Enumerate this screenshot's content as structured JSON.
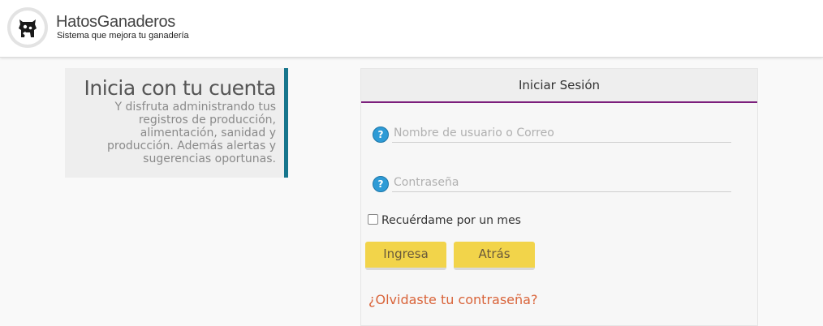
{
  "header": {
    "brand_title": "HatosGanaderos",
    "brand_subtitle": "Sistema que mejora tu ganadería",
    "logo_icon": "cow-icon"
  },
  "promo": {
    "title": "Inicia con tu cuenta",
    "text": "Y disfruta administrando tus registros de producción, alimentación, sanidad y producción. Además alertas y sugerencias oportunas.",
    "accent_color": "#16758c"
  },
  "login": {
    "title": "Iniciar Sesión",
    "username_placeholder": "Nombre de usuario o Correo",
    "username_value": "",
    "password_placeholder": "Contraseña",
    "password_value": "",
    "help_icon": "help-icon",
    "remember_label": "Recuérdame por un mes",
    "remember_checked": false,
    "submit_label": "Ingresa",
    "back_label": "Atrás",
    "forgot_label": "¿Olvidaste tu contraseña?",
    "header_underline_color": "#7c1f7c",
    "button_color": "#f2d44a",
    "link_color": "#d9643a"
  }
}
